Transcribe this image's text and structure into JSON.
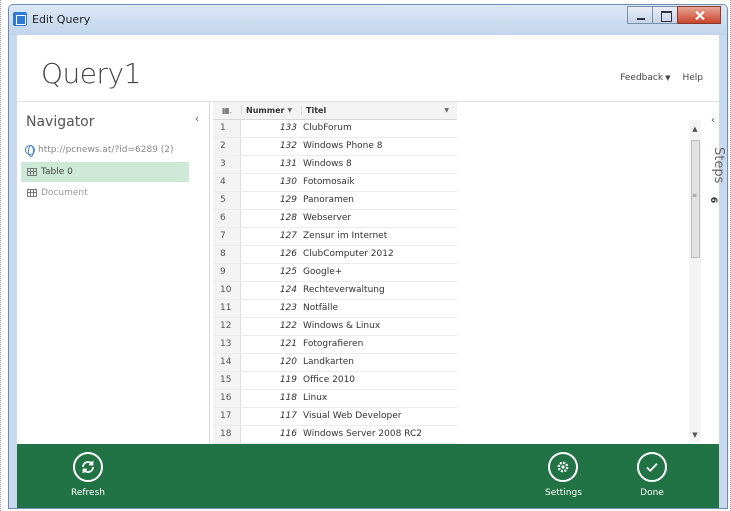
{
  "window": {
    "title": "Edit Query"
  },
  "header": {
    "query_name": "Query1",
    "feedback": "Feedback",
    "help": "Help"
  },
  "navigator": {
    "title": "Navigator",
    "source": "http://pcnews.at/?id=6289 (2)",
    "items": [
      {
        "label": "Table 0",
        "selected": true
      },
      {
        "label": "Document",
        "selected": false
      }
    ]
  },
  "grid": {
    "columns": [
      "Nummer",
      "Titel"
    ],
    "rows": [
      {
        "idx": "1",
        "nummer": "133",
        "titel": "ClubForum"
      },
      {
        "idx": "2",
        "nummer": "132",
        "titel": "Windows Phone 8"
      },
      {
        "idx": "3",
        "nummer": "131",
        "titel": "Windows 8"
      },
      {
        "idx": "4",
        "nummer": "130",
        "titel": "Fotomosaik"
      },
      {
        "idx": "5",
        "nummer": "129",
        "titel": "Panoramen"
      },
      {
        "idx": "6",
        "nummer": "128",
        "titel": "Webserver"
      },
      {
        "idx": "7",
        "nummer": "127",
        "titel": "Zensur im Internet"
      },
      {
        "idx": "8",
        "nummer": "126",
        "titel": "ClubComputer 2012"
      },
      {
        "idx": "9",
        "nummer": "125",
        "titel": "Google+"
      },
      {
        "idx": "10",
        "nummer": "124",
        "titel": "Rechteverwaltung"
      },
      {
        "idx": "11",
        "nummer": "123",
        "titel": "Notfälle"
      },
      {
        "idx": "12",
        "nummer": "122",
        "titel": "Windows & Linux"
      },
      {
        "idx": "13",
        "nummer": "121",
        "titel": "Fotografieren"
      },
      {
        "idx": "14",
        "nummer": "120",
        "titel": "Landkarten"
      },
      {
        "idx": "15",
        "nummer": "119",
        "titel": "Office 2010"
      },
      {
        "idx": "16",
        "nummer": "118",
        "titel": "Linux"
      },
      {
        "idx": "17",
        "nummer": "117",
        "titel": "Visual Web Developer"
      },
      {
        "idx": "18",
        "nummer": "116",
        "titel": "Windows Server 2008 RC2"
      }
    ]
  },
  "steps": {
    "label": "Steps",
    "count": "6"
  },
  "footer": {
    "refresh": "Refresh",
    "settings": "Settings",
    "done": "Done"
  },
  "colors": {
    "footer": "#217346",
    "selected_nav": "#cfe9d8"
  }
}
